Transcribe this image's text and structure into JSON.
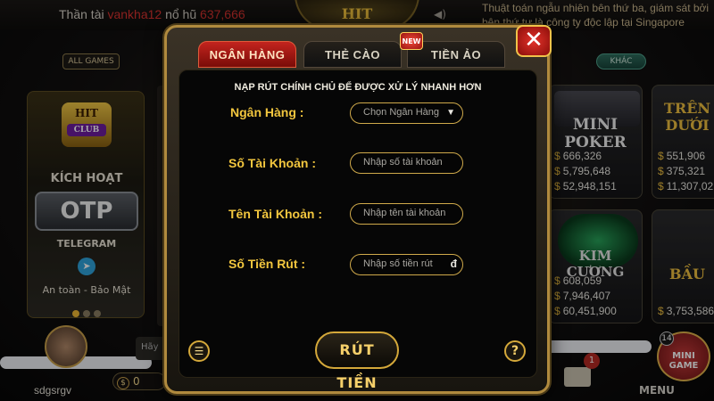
{
  "top": {
    "jackpot_label": "Thần tài",
    "jackpot_user": "vankha12",
    "jackpot_mid": "nổ hũ",
    "jackpot_amount": "637,666",
    "ticker": "Thuật toán ngẫu nhiên bên thứ ba, giám sát bởi bên thứ tư là công ty độc lập tại Singapore",
    "logo_text": "HIT"
  },
  "left": {
    "all_games": "ALL GAMES",
    "promo": {
      "logo": "HIT",
      "club": "CLUB",
      "activate": "KÍCH HOẠT",
      "otp": "OTP",
      "telegram": "TELEGRAM",
      "safe": "An toàn - Bảo Mật"
    },
    "username": "sdgsrgv",
    "balance": "0",
    "chat_hint": "Hãy"
  },
  "right": {
    "filter": "KHÁC",
    "games": [
      {
        "name": "MINI POKER",
        "stats": [
          "666,326",
          "5,795,648",
          "52,948,151"
        ]
      },
      {
        "name": "KIM CƯƠNG",
        "stats": [
          "608,059",
          "7,946,407",
          "60,451,900"
        ]
      },
      {
        "name": "TRÊN DƯỚI",
        "stats": [
          "551,906",
          "375,321",
          "11,307,02"
        ]
      },
      {
        "name": "BẦU",
        "stats": [
          "3,753,586"
        ]
      }
    ],
    "currency_symbol": "$",
    "mail_badge": "1",
    "mini_game_count": "14",
    "mini_game_label": "MINI GAME",
    "menu": "MENU"
  },
  "dialog": {
    "tabs": {
      "bank": "NGÂN HÀNG",
      "card": "THẺ CÀO",
      "crypto": "TIỀN ẢO"
    },
    "new_badge": "NEW",
    "close": "✕",
    "notice": "NẠP RÚT CHÍNH CHỦ ĐỂ ĐƯỢC XỬ LÝ NHANH HƠN",
    "fields": {
      "bank": {
        "label": "Ngân Hàng :",
        "value": "Chọn Ngân Hàng"
      },
      "account_number": {
        "label": "Số Tài Khoản :",
        "placeholder": "Nhập số tài  khoản"
      },
      "account_name": {
        "label": "Tên Tài Khoản :",
        "placeholder": "Nhập tên tài khoản"
      },
      "amount": {
        "label": "Số Tiền Rút :",
        "placeholder": "Nhập số tiền rút",
        "currency": "đ"
      }
    },
    "withdraw_button": "RÚT TIỀN",
    "help": "?"
  },
  "colors": {
    "accent_gold": "#f2c63e",
    "tab_active": "#c3241e",
    "field_border": "#cfa94a"
  }
}
